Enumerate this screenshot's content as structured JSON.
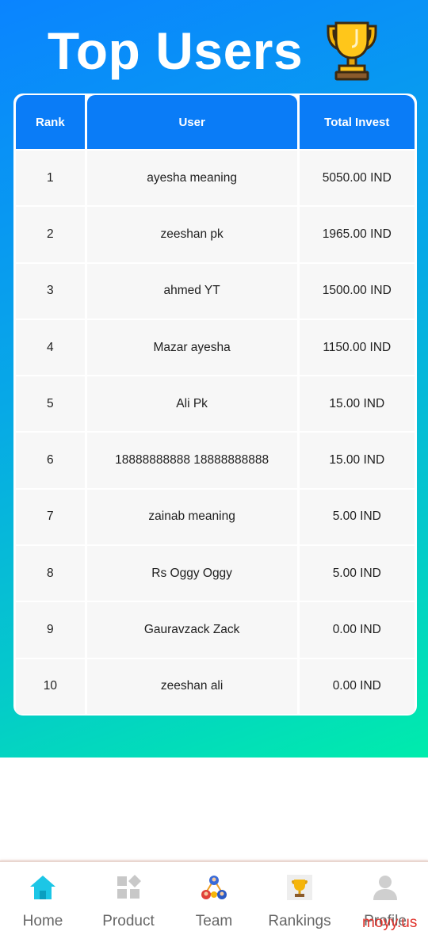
{
  "header": {
    "title": "Top Users"
  },
  "table": {
    "columns": [
      "Rank",
      "User",
      "Total Invest"
    ],
    "rows": [
      {
        "rank": "1",
        "user": "ayesha meaning",
        "invest": "5050.00 IND"
      },
      {
        "rank": "2",
        "user": "zeeshan pk",
        "invest": "1965.00 IND"
      },
      {
        "rank": "3",
        "user": "ahmed YT",
        "invest": "1500.00 IND"
      },
      {
        "rank": "4",
        "user": "Mazar ayesha",
        "invest": "1150.00 IND"
      },
      {
        "rank": "5",
        "user": "Ali Pk",
        "invest": "15.00 IND"
      },
      {
        "rank": "6",
        "user": "18888888888 18888888888",
        "invest": "15.00 IND"
      },
      {
        "rank": "7",
        "user": "zainab meaning",
        "invest": "5.00 IND"
      },
      {
        "rank": "8",
        "user": "Rs Oggy Oggy",
        "invest": "5.00 IND"
      },
      {
        "rank": "9",
        "user": "Gauravzack Zack",
        "invest": "0.00 IND"
      },
      {
        "rank": "10",
        "user": "zeeshan ali",
        "invest": "0.00 IND"
      }
    ]
  },
  "nav": {
    "items": [
      {
        "label": "Home",
        "icon": "home-icon"
      },
      {
        "label": "Product",
        "icon": "product-grid-icon"
      },
      {
        "label": "Team",
        "icon": "team-icon"
      },
      {
        "label": "Rankings",
        "icon": "trophy-icon"
      },
      {
        "label": "Profile",
        "icon": "user-icon"
      }
    ]
  },
  "watermark": "moyy.us",
  "colors": {
    "accent": "#0a7cf7",
    "gradient_start": "#0a84ff",
    "gradient_end": "#00ecac",
    "home_active": "#1cc6e6"
  }
}
